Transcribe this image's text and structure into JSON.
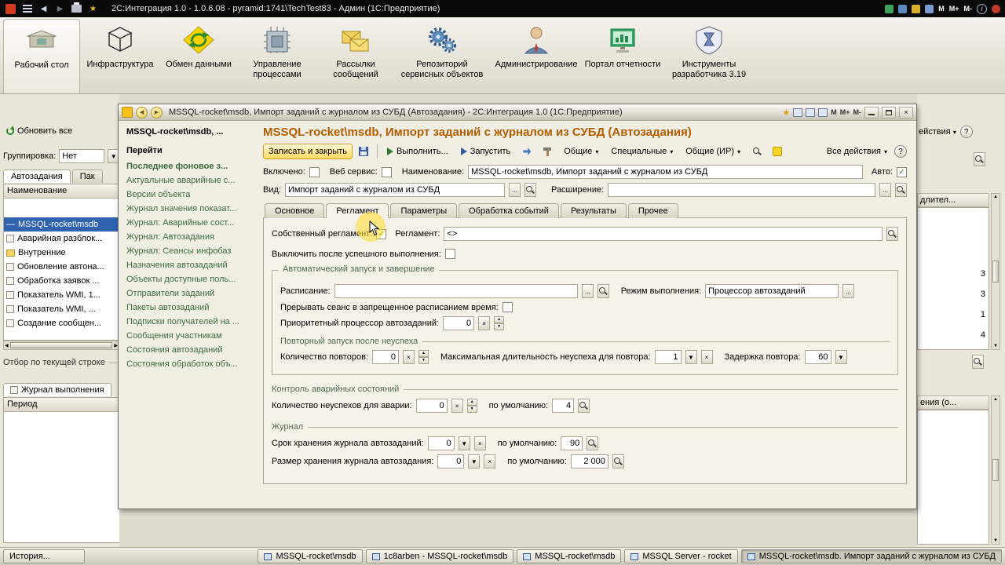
{
  "glyphs": {
    "ellipsis": "...",
    "caret": "▾",
    "drop": "▼",
    "up": "▲",
    "down": "▼",
    "left": "◀",
    "right": "▶",
    "clear": "×",
    "close": "×",
    "check": "✓",
    "help": "?",
    "star": "★",
    "info": "i"
  },
  "app": {
    "titlebar_title": "2С:Интеграция 1.0 - 1.0.6.08 - pyramid:1741\\TechTest83 - Админ (1С:Предприятие)",
    "mem": [
      "M",
      "M+",
      "M-"
    ]
  },
  "toolbar": {
    "items": [
      "Рабочий стол",
      "Инфраструктура",
      "Обмен данными",
      "Управление процессами",
      "Рассылки сообщений",
      "Репозиторий сервисных объектов",
      "Администрирование",
      "Портал отчетности",
      "Инструменты разработчика 3.19"
    ]
  },
  "sidebar": {
    "refresh_all": "Обновить все",
    "grouping_label": "Группировка:",
    "grouping_value": "Нет",
    "tab_auto": "Автозадания",
    "tab_pak": "Пак",
    "list_header": "Наименование",
    "items": [
      "MSSQL-rocket\\msdb",
      "Аварийная разблок...",
      "Внутренние",
      "Обновление автона...",
      "Обработка заявок ...",
      "Показатель WMI, 1...",
      "Показатель WMI, ...",
      "Создание сообщен..."
    ],
    "filter_caption": "Отбор по текущей строке",
    "journal_tab": "Журнал выполнения",
    "journal_col": "Период",
    "history": "История..."
  },
  "right": {
    "actions_fragment": "ействия",
    "col_fragment": "длител...",
    "rows": [
      "3",
      "3",
      "1",
      "4"
    ],
    "bottom_fragment": "ения (о..."
  },
  "dialog": {
    "title": "MSSQL-rocket\\msdb, Импорт заданий с журналом из СУБД (Автозадания) - 2С:Интеграция 1.0 (1С:Предприятие)",
    "nav": {
      "header": "MSSQL-rocket\\msdb, ...",
      "goto": "Перейти",
      "last_bg": "Последнее фоновое з...",
      "links": [
        "Актуальные аварийные с...",
        "Версии объекта",
        "Журнал значения показат...",
        "Журнал: Аварийные сост...",
        "Журнал: Автозадания",
        "Журнал: Сеансы инфобаз",
        "Назначения автозаданий",
        "Объекты доступные поль...",
        "Отправители заданий",
        "Пакеты автозаданий",
        "Подписки получателей на ...",
        "Сообщения участникам",
        "Состояния автозаданий",
        "Состояния обработок объ..."
      ]
    },
    "form": {
      "title": "MSSQL-rocket\\msdb, Импорт заданий с журналом из СУБД (Автозадания)",
      "commands": {
        "save_close": "Записать и закрыть",
        "execute": "Выполнить...",
        "start": "Запустить",
        "common": "Общие",
        "special": "Специальные",
        "common_ir": "Общие (ИР)",
        "all_actions": "Все действия"
      },
      "fields": {
        "enabled": "Включено:",
        "web": "Веб сервис:",
        "name": "Наименование:",
        "name_value": "MSSQL-rocket\\msdb, Импорт заданий с журналом из СУБД",
        "auto": "Авто:",
        "kind": "Вид:",
        "kind_value": "Импорт заданий с журналом из СУБД",
        "ext": "Расширение:",
        "ext_value": ""
      },
      "tabs": [
        "Основное",
        "Регламент",
        "Параметры",
        "Обработка событий",
        "Результаты",
        "Прочее"
      ],
      "reg": {
        "own": "Собственный регламент:",
        "reglament": "Регламент:",
        "reglament_value": "<>",
        "off_after": "Выключить после успешного выполнения:",
        "auto_group": "Автоматический запуск и завершение",
        "schedule": "Расписание:",
        "schedule_value": "",
        "mode": "Режим выполнения:",
        "mode_value": "Процессор автозаданий",
        "interrupt": "Прерывать сеанс в запрещенное расписанием время:",
        "priority": "Приоритетный процессор автозаданий:",
        "priority_value": "0",
        "retry_group": "Повторный запуск после неуспеха",
        "retry_count": "Количество повторов:",
        "retry_count_value": "0",
        "max_dur": "Максимальная длительность неуспеха для повтора:",
        "max_dur_value": "1",
        "delay": "Задержка повтора:",
        "delay_value": "60",
        "ctrl_group": "Контроль аварийных состояний",
        "fails": "Количество неуспехов для аварии:",
        "fails_value": "0",
        "default_lbl": "по умолчанию:",
        "fails_default": "4",
        "journal_group": "Журнал",
        "store_term": "Срок хранения журнала автозаданий:",
        "store_term_value": "0",
        "store_term_default": "90",
        "store_size": "Размер хранения журнала автозадания:",
        "store_size_value": "0",
        "store_size_default": "2 000"
      }
    }
  },
  "taskbar": {
    "items": [
      "MSSQL-rocket\\msdb",
      "1c8arben - MSSQL-rocket\\msdb",
      "MSSQL-rocket\\msdb",
      "MSSQL Server - rocket",
      "MSSQL-rocket\\msdb. Импорт заданий с журналом из СУБД"
    ]
  }
}
